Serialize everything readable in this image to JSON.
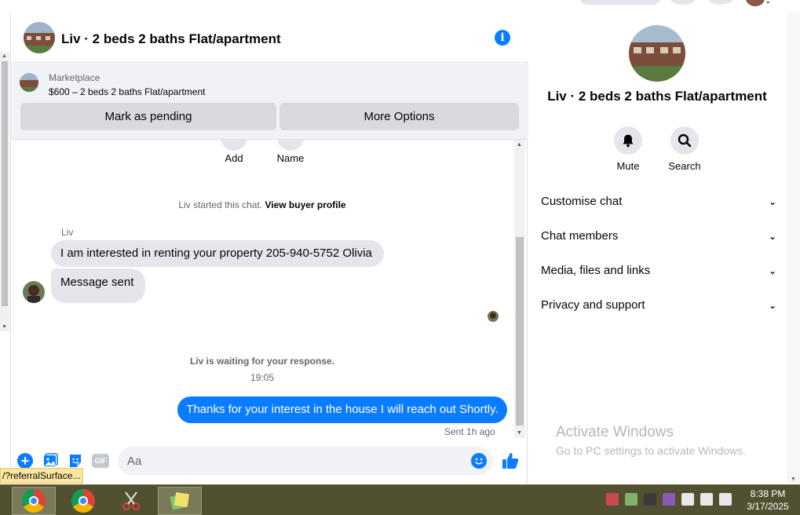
{
  "chat": {
    "title": "Liv · 2 beds 2 baths Flat/apartment",
    "marketplace_label": "Marketplace",
    "listing": "$600 – 2 beds 2 baths Flat/apartment",
    "mark_pending_label": "Mark as pending",
    "more_options_label": "More Options",
    "quick_actions": [
      "Add",
      "Name"
    ],
    "started_text": "Liv started this chat.",
    "view_profile_link": "View buyer profile",
    "sender_name": "Liv",
    "incoming_messages": [
      "I am interested in renting your property 205-940-5752 Olivia",
      "Message sent"
    ],
    "waiting_text": "Liv is waiting for your response.",
    "timestamp": "19:05",
    "outgoing_message": "Thanks for your interest in the house I will reach out Shortly.",
    "sent_status": "Sent 1h ago",
    "composer_placeholder": "Aa",
    "gif_label": "GIF"
  },
  "status_url": "/?referralSurface...",
  "side": {
    "title": "Liv · 2 beds 2 baths Flat/apartment",
    "mute_label": "Mute",
    "search_label": "Search",
    "sections": [
      "Customise chat",
      "Chat members",
      "Media, files and links",
      "Privacy and support"
    ]
  },
  "watermark": {
    "title": "Activate Windows",
    "subtitle": "Go to PC settings to activate Windows."
  },
  "taskbar": {
    "time": "8:38 PM",
    "date": "3/17/2025"
  },
  "colors": {
    "accent": "#0a7cff",
    "bubble_in": "#e4e6eb",
    "taskbar": "#515132"
  }
}
